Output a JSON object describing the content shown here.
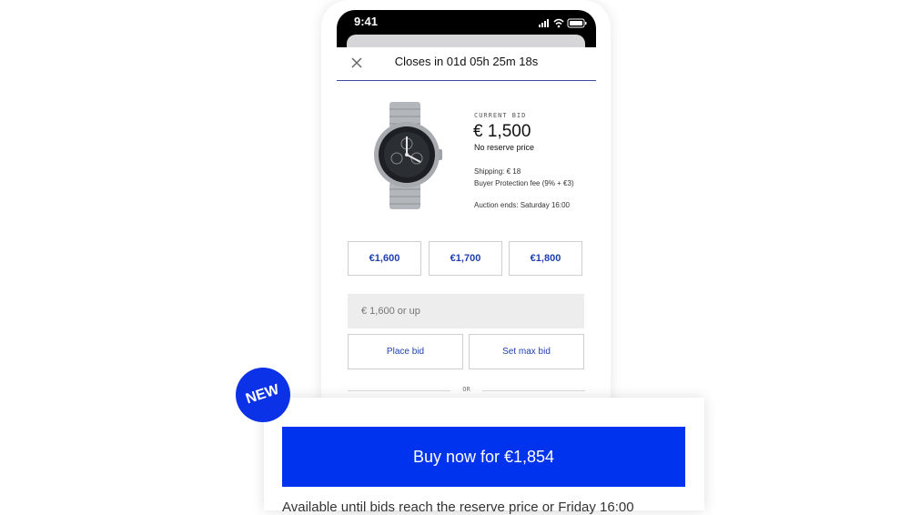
{
  "status_bar": {
    "time": "9:41",
    "icons": [
      "signal-icon",
      "wifi-icon",
      "battery-icon"
    ]
  },
  "header": {
    "close_icon": "close-icon",
    "closes_text": "Closes in 01d 05h 25m 18s"
  },
  "lot": {
    "image": "watch-image",
    "current_bid_label": "CURRENT BID",
    "current_bid_value": "€ 1,500",
    "reserve_text": "No reserve price",
    "shipping": "Shipping: € 18",
    "protection": "Buyer Protection fee (9% + €3)",
    "auction_ends": "Auction ends: Saturday 16:00"
  },
  "bid_options": [
    "€1,600",
    "€1,700",
    "€1,800"
  ],
  "bid_input": {
    "placeholder": "€ 1,600 or up"
  },
  "actions": {
    "place_bid": "Place bid",
    "set_max_bid": "Set max bid"
  },
  "or_label": "OR",
  "buy_now": {
    "badge": "NEW",
    "label": "Buy now for €1,854",
    "available_text": "Available until bids reach the reserve price or Friday 16:00"
  },
  "colors": {
    "accent_blue": "#0033ee",
    "link_blue": "#1f3fb0",
    "badge_blue": "#0c32e8",
    "input_bg": "#ededee"
  }
}
